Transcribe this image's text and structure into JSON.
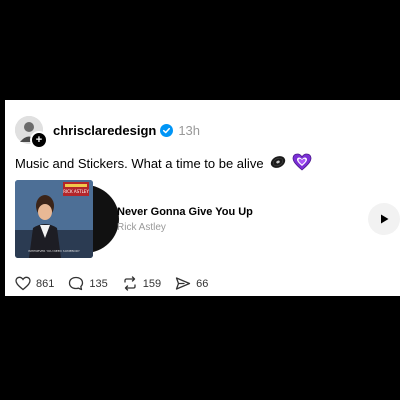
{
  "post": {
    "username": "chrisclaredesign",
    "timestamp": "13h",
    "text": "Music and Stickers. What a time to be alive",
    "stickers": [
      "vinyl-record-sticker",
      "purple-heart-sticker"
    ],
    "verified_color": "#0095f6"
  },
  "music": {
    "title": "Never Gonna Give You Up",
    "artist": "Rick Astley",
    "album_art_text": {
      "top_label": "RICK ASTLEY",
      "bottom_label": "WHENEVER YOU NEED SOMEBODY"
    }
  },
  "actions": {
    "likes": "861",
    "comments": "135",
    "reposts": "159",
    "shares": "66"
  }
}
